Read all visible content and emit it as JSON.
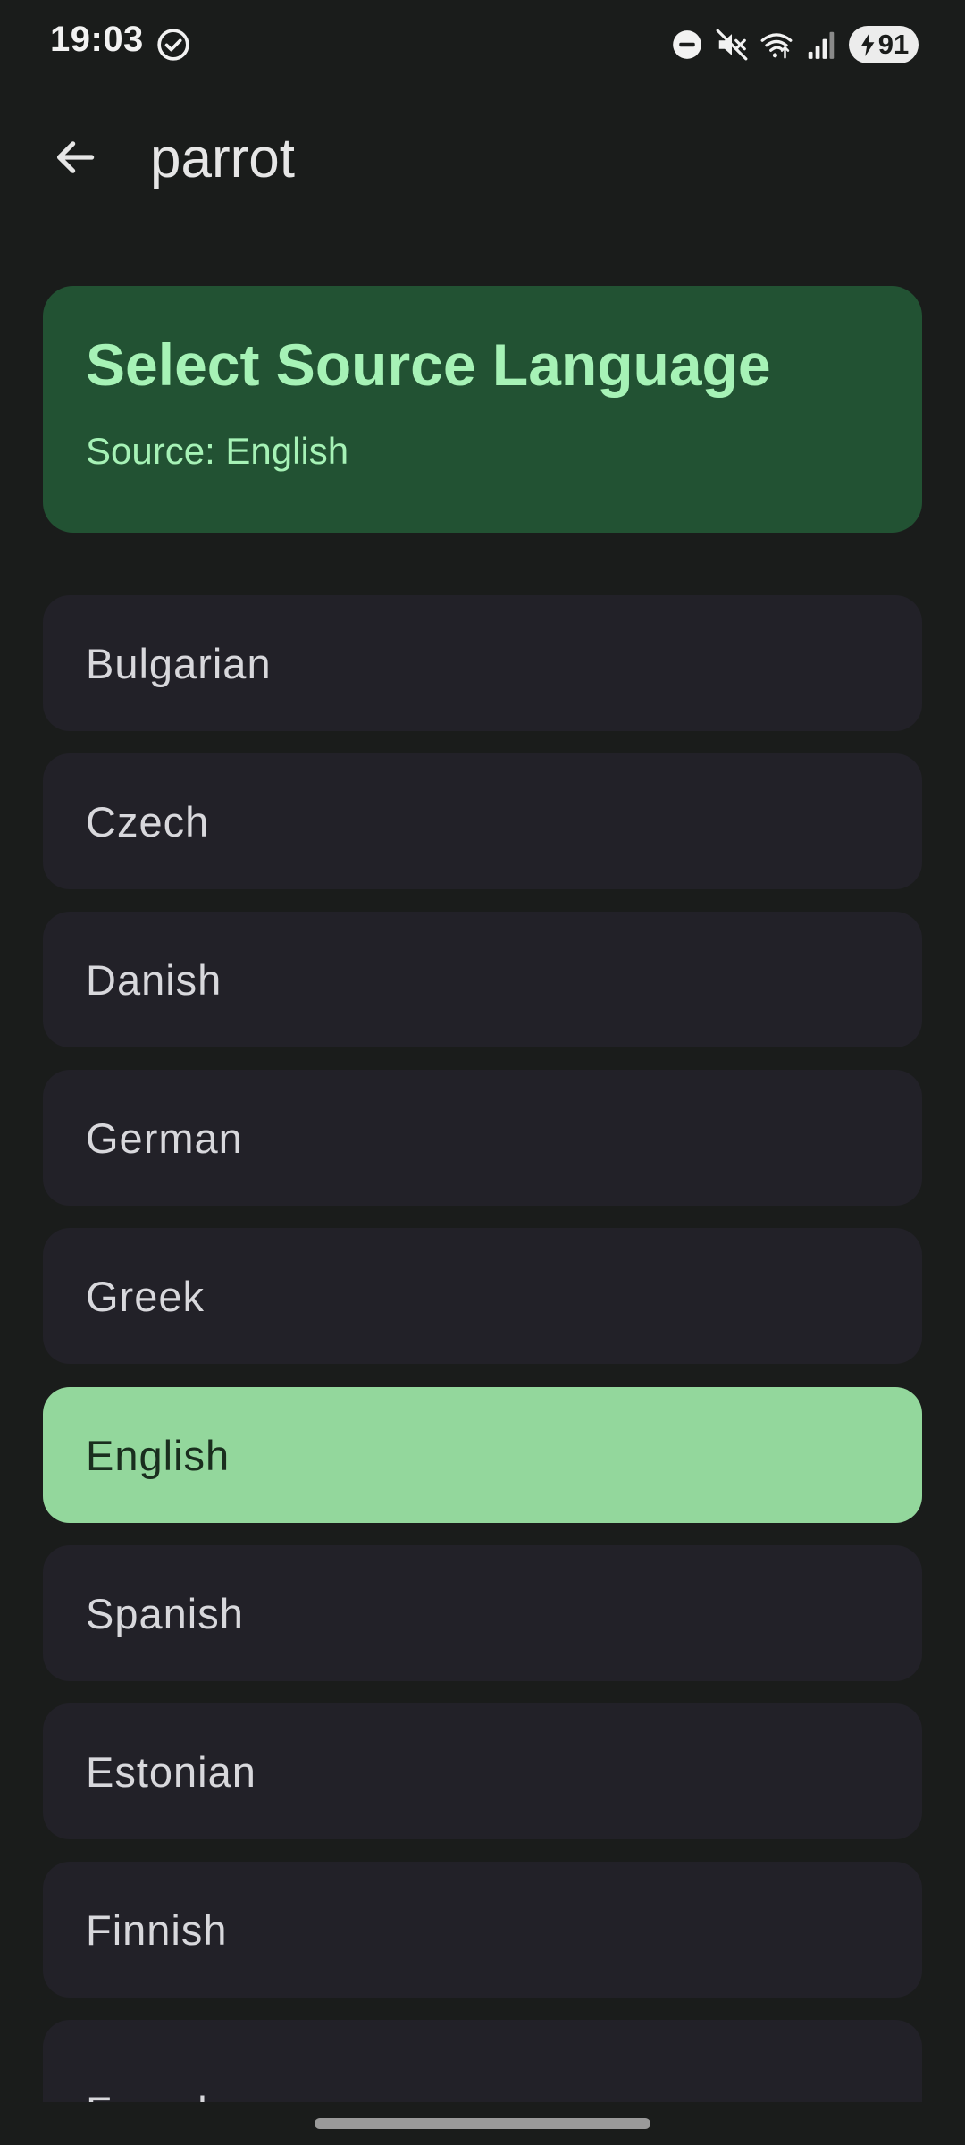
{
  "status_bar": {
    "time": "19:03",
    "battery_level": "91",
    "icons": [
      "check-circle-icon",
      "do-not-disturb-icon",
      "mute-icon",
      "wifi-icon",
      "signal-icon",
      "battery-charging-icon"
    ]
  },
  "app_bar": {
    "title": "parrot",
    "back_icon": "arrow-back-icon"
  },
  "header": {
    "title": "Select Source Language",
    "subtitle": "Source: English"
  },
  "languages": [
    {
      "label": "Bulgarian",
      "selected": false
    },
    {
      "label": "Czech",
      "selected": false
    },
    {
      "label": "Danish",
      "selected": false
    },
    {
      "label": "German",
      "selected": false
    },
    {
      "label": "Greek",
      "selected": false
    },
    {
      "label": "English",
      "selected": true
    },
    {
      "label": "Spanish",
      "selected": false
    },
    {
      "label": "Estonian",
      "selected": false
    },
    {
      "label": "Finnish",
      "selected": false
    },
    {
      "label": "French",
      "selected": false
    }
  ],
  "colors": {
    "background": "#1a1c1b",
    "header_card": "#225233",
    "header_text": "#a6f2b6",
    "item_background": "#222128",
    "selected_background": "#93d79c"
  }
}
